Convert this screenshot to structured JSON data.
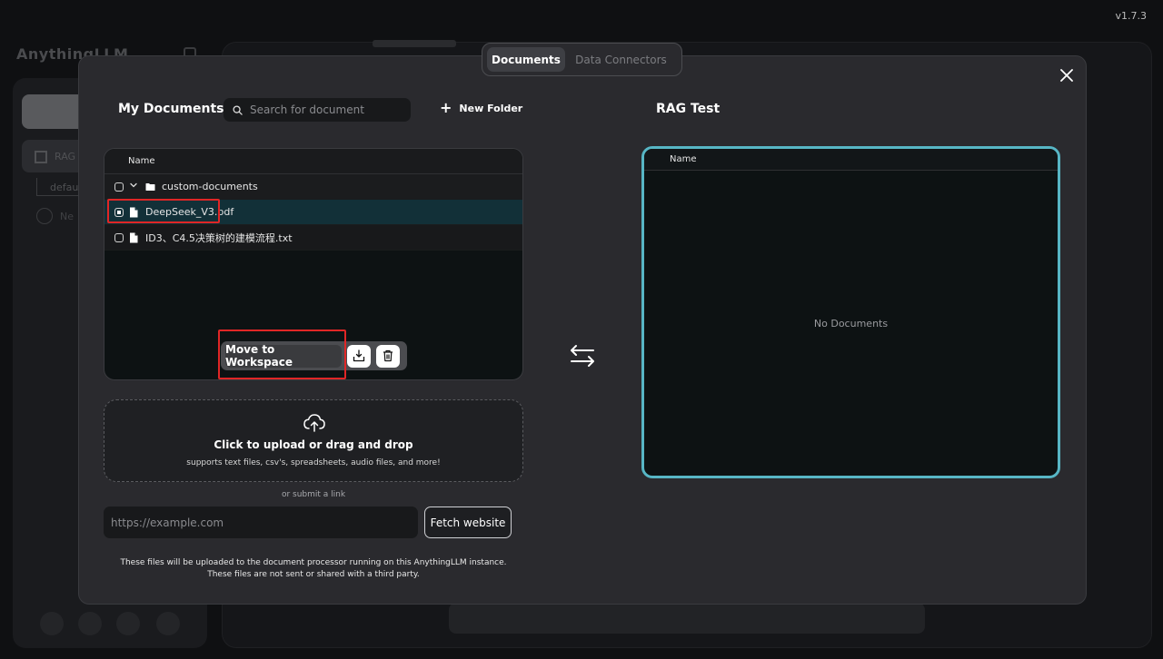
{
  "app": {
    "version": "v1.7.3",
    "brand": "AnythingLLM",
    "workspace_label": "RAG",
    "thread_label": "defau",
    "new_thread_label": "Ne"
  },
  "modal": {
    "tabs": [
      {
        "label": "Documents",
        "active": true
      },
      {
        "label": "Data Connectors",
        "active": false
      }
    ],
    "my_documents": {
      "title": "My Documents",
      "search_placeholder": "Search for document",
      "new_folder_label": "New Folder",
      "column_name": "Name",
      "folder": {
        "name": "custom-documents",
        "expanded": true
      },
      "files": [
        {
          "name": "DeepSeek_V3.pdf",
          "selected": true
        },
        {
          "name": "ID3、C4.5决策树的建模流程.txt",
          "selected": false
        }
      ],
      "actions": {
        "move_label": "Move to Workspace"
      }
    },
    "upload": {
      "title": "Click to upload or drag and drop",
      "subtitle": "supports text files, csv's, spreadsheets, audio files, and more!",
      "or_link": "or submit a link",
      "url_placeholder": "https://example.com",
      "fetch_label": "Fetch website",
      "note_line1": "These files will be uploaded to the document processor running on this AnythingLLM instance.",
      "note_line2": "These files are not sent or shared with a third party."
    },
    "workspace": {
      "title": "RAG Test",
      "column_name": "Name",
      "empty_text": "No Documents"
    }
  },
  "colors": {
    "accent_border": "#57b6c5",
    "highlight_red": "#e02626",
    "selected_row": "#123038"
  }
}
